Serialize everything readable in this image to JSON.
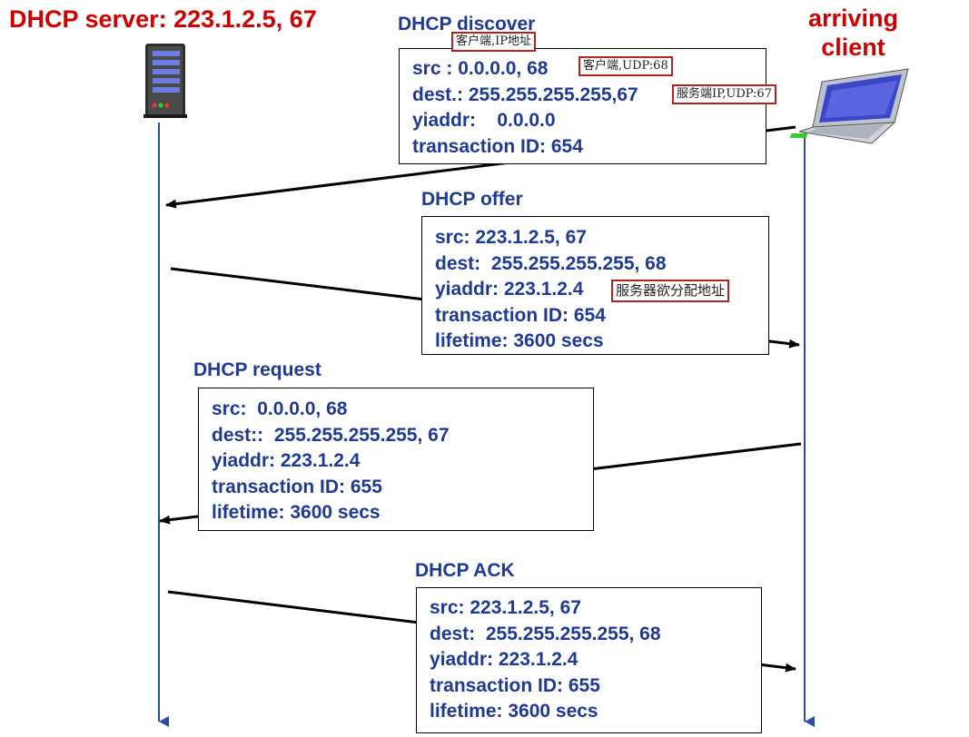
{
  "server_title": "DHCP server: 223.1.2.5, 67",
  "client_title": [
    "arriving",
    "client"
  ],
  "colors": {
    "title": "#cc0000",
    "text": "#1f3a93",
    "timeline": "#2a4aa8",
    "annotation_border": "#b22222"
  },
  "messages": {
    "discover": {
      "title": "DHCP discover",
      "lines": [
        "src : 0.0.0.0, 68",
        "dest.: 255.255.255.255,67",
        "yiaddr:    0.0.0.0",
        "transaction ID: 654"
      ],
      "annotations": {
        "title": "客户端,IP地址",
        "src": "客户端,UDP:68",
        "dest": "服务端IP,UDP:67"
      }
    },
    "offer": {
      "title": "DHCP offer",
      "lines": [
        "src: 223.1.2.5, 67",
        "dest:  255.255.255.255, 68",
        "yiaddr: 223.1.2.4",
        "transaction ID: 654",
        "lifetime: 3600 secs"
      ],
      "annotations": {
        "yiaddr": "服务器欲分配地址"
      }
    },
    "request": {
      "title": "DHCP request",
      "lines": [
        "src:  0.0.0.0, 68",
        "dest::  255.255.255.255, 67",
        "yiaddr: 223.1.2.4",
        "transaction ID: 655",
        "lifetime: 3600 secs"
      ]
    },
    "ack": {
      "title": "DHCP ACK",
      "lines": [
        "src: 223.1.2.5, 67",
        "dest:  255.255.255.255, 68",
        "yiaddr: 223.1.2.4",
        "transaction ID: 655",
        "lifetime: 3600 secs"
      ]
    }
  }
}
